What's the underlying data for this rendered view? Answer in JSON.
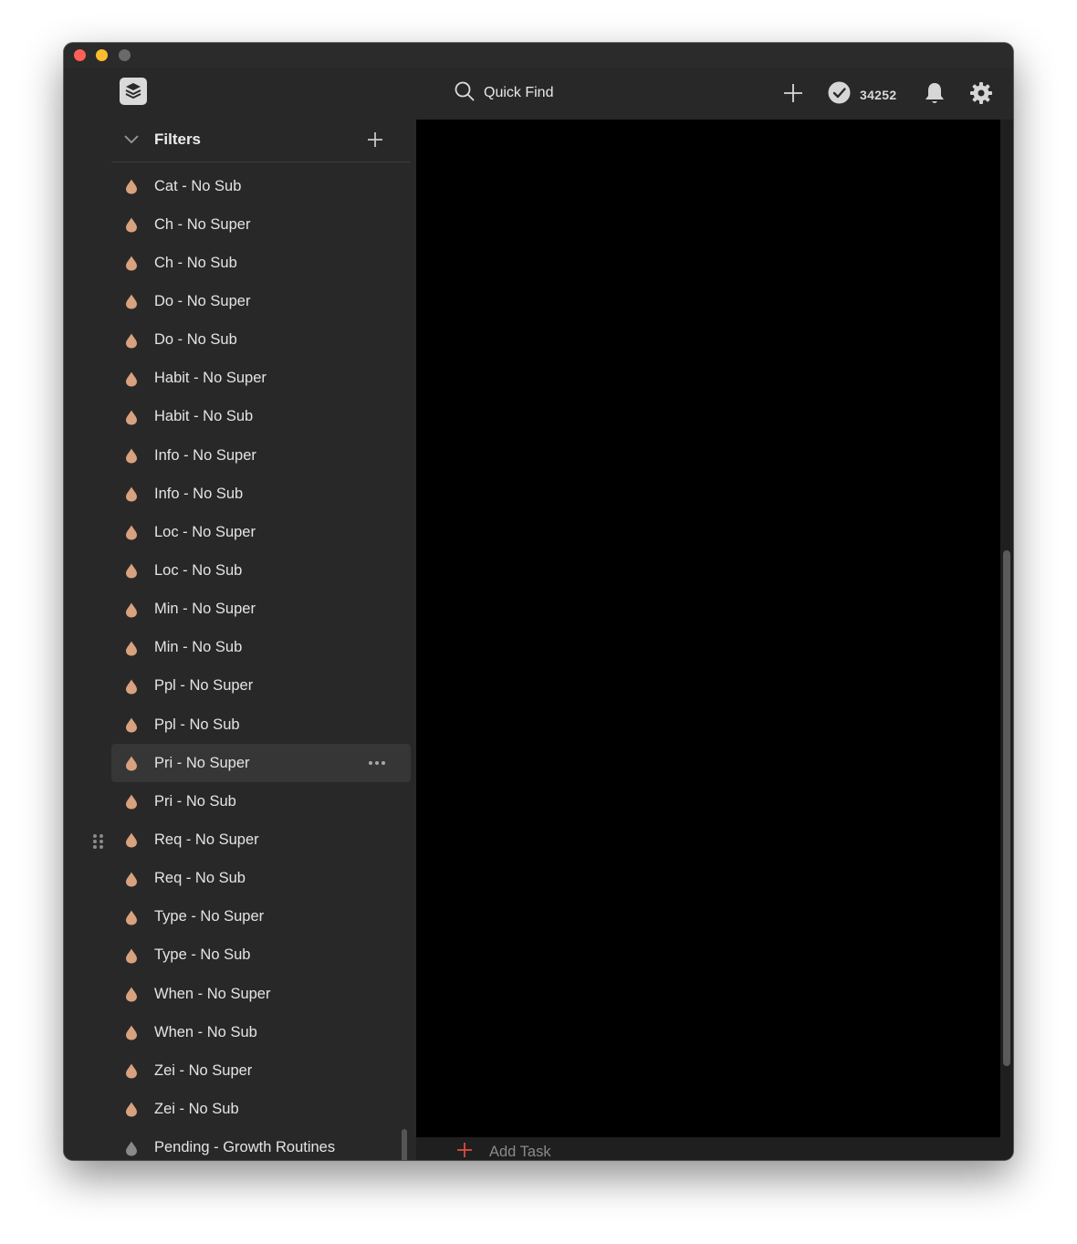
{
  "window": {
    "title": ""
  },
  "topbar": {
    "search": {
      "label": "Quick Find"
    },
    "karma": {
      "count": "34252"
    }
  },
  "sidebar": {
    "section_title": "Filters",
    "items": [
      {
        "label": "Cat - No Sub",
        "color": "#d8a27f"
      },
      {
        "label": "Ch - No Super",
        "color": "#d8a27f"
      },
      {
        "label": "Ch - No Sub",
        "color": "#d8a27f"
      },
      {
        "label": "Do - No Super",
        "color": "#d8a27f"
      },
      {
        "label": "Do - No Sub",
        "color": "#d8a27f"
      },
      {
        "label": "Habit - No Super",
        "color": "#d8a27f"
      },
      {
        "label": "Habit - No Sub",
        "color": "#d8a27f"
      },
      {
        "label": "Info - No Super",
        "color": "#d8a27f"
      },
      {
        "label": "Info - No Sub",
        "color": "#d8a27f"
      },
      {
        "label": "Loc - No Super",
        "color": "#d8a27f"
      },
      {
        "label": "Loc - No Sub",
        "color": "#d8a27f"
      },
      {
        "label": "Min - No Super",
        "color": "#d8a27f"
      },
      {
        "label": "Min - No Sub",
        "color": "#d8a27f"
      },
      {
        "label": "Ppl - No Super",
        "color": "#d8a27f"
      },
      {
        "label": "Ppl - No Sub",
        "color": "#d8a27f"
      },
      {
        "label": "Pri - No Super",
        "color": "#d8a27f"
      },
      {
        "label": "Pri - No Sub",
        "color": "#d8a27f"
      },
      {
        "label": "Req - No Super",
        "color": "#d8a27f"
      },
      {
        "label": "Req - No Sub",
        "color": "#d8a27f"
      },
      {
        "label": "Type - No Super",
        "color": "#d8a27f"
      },
      {
        "label": "Type - No Sub",
        "color": "#d8a27f"
      },
      {
        "label": "When - No Super",
        "color": "#d8a27f"
      },
      {
        "label": "When - No Sub",
        "color": "#d8a27f"
      },
      {
        "label": "Zei - No Super",
        "color": "#d8a27f"
      },
      {
        "label": "Zei - No Sub",
        "color": "#d8a27f"
      },
      {
        "label": "Pending - Growth Routines",
        "color": "#8a8a8a"
      }
    ]
  },
  "main": {
    "add_task_label": "Add Task"
  },
  "colors": {
    "accent": "#db4c3f",
    "filter_icon": "#d8a27f",
    "background": "#1f1f1f",
    "sidebar": "#282828"
  }
}
